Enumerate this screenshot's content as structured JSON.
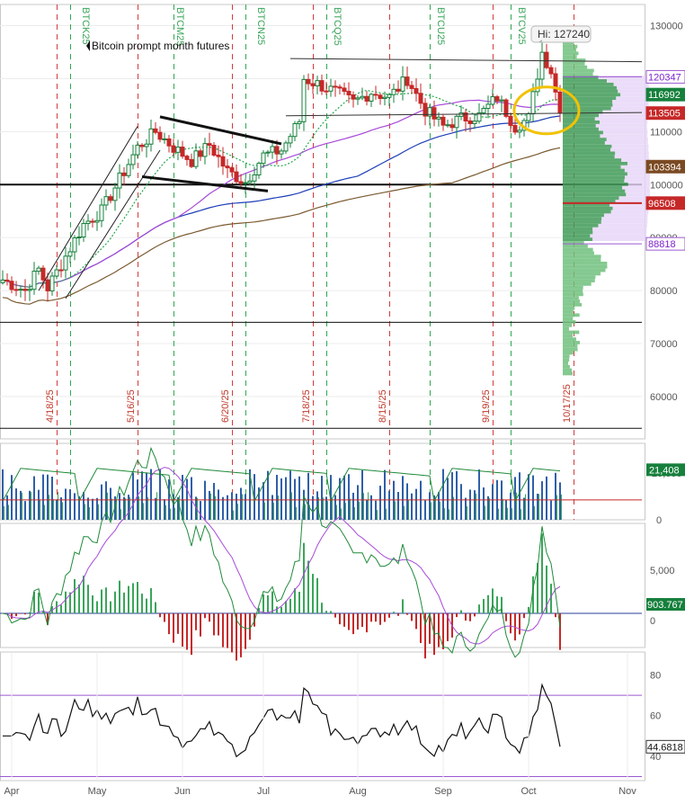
{
  "chart_data": [
    {
      "panel": "price",
      "type": "candlestick",
      "title": "Bitcoin prompt month futures",
      "annotation_high": "Hi: 127240",
      "ylim": [
        52000,
        134000
      ],
      "y_ticks": [
        {
          "value": 130000,
          "label": "130000"
        },
        {
          "value": 120000,
          "label": "120000"
        },
        {
          "value": 110000,
          "label": "110000"
        },
        {
          "value": 100000,
          "label": "100000"
        },
        {
          "value": 90000,
          "label": "90000"
        },
        {
          "value": 80000,
          "label": "80000"
        },
        {
          "value": 70000,
          "label": "70000"
        },
        {
          "value": 60000,
          "label": "60000"
        }
      ],
      "price_labels": [
        {
          "value": 120347,
          "label": "120347",
          "color": "#7e22ce",
          "bg": "#ffffff"
        },
        {
          "value": 116992,
          "label": "116992",
          "color": "#ffffff",
          "bg": "#16803c"
        },
        {
          "value": 113505,
          "label": "113505",
          "color": "#ffffff",
          "bg": "#c62828"
        },
        {
          "value": 103394,
          "label": "103394",
          "color": "#ffffff",
          "bg": "#7b4a22"
        },
        {
          "value": 96508,
          "label": "96508",
          "color": "#ffffff",
          "bg": "#c62828"
        },
        {
          "value": 88818,
          "label": "88818",
          "color": "#7e22ce",
          "bg": "#ffffff"
        }
      ],
      "contract_labels": [
        "BTCK25",
        "BTCM25",
        "BTCN25",
        "BTCQ25",
        "BTCU25",
        "BTCV25"
      ],
      "expiry_dates": [
        "4/18/25",
        "5/16/25",
        "6/20/25",
        "7/18/25",
        "8/15/25",
        "9/19/25",
        "10/17/25"
      ],
      "horizontal_levels": [
        100000,
        74000,
        54000
      ],
      "anchors": [
        [
          0,
          82000
        ],
        [
          5,
          80000
        ],
        [
          8,
          84000
        ],
        [
          10,
          80500
        ],
        [
          14,
          86500
        ],
        [
          18,
          92500
        ],
        [
          22,
          95000
        ],
        [
          26,
          101000
        ],
        [
          30,
          107000
        ],
        [
          34,
          110000
        ],
        [
          38,
          107000
        ],
        [
          42,
          104500
        ],
        [
          46,
          107500
        ],
        [
          50,
          102500
        ],
        [
          54,
          100500
        ],
        [
          58,
          105500
        ],
        [
          62,
          106500
        ],
        [
          66,
          112000
        ],
        [
          67,
          120000
        ],
        [
          70,
          119000
        ],
        [
          74,
          117500
        ],
        [
          78,
          115500
        ],
        [
          82,
          117500
        ],
        [
          86,
          116500
        ],
        [
          90,
          120000
        ],
        [
          94,
          114000
        ],
        [
          98,
          111000
        ],
        [
          102,
          112500
        ],
        [
          106,
          113000
        ],
        [
          110,
          116500
        ],
        [
          114,
          111000
        ],
        [
          117,
          112500
        ],
        [
          120,
          125000
        ],
        [
          122,
          121500
        ],
        [
          124,
          113505
        ]
      ]
    },
    {
      "panel": "volume",
      "type": "bar",
      "value_label": "21,408",
      "y_ticks": [
        {
          "value": 20000,
          "label": "20,000"
        },
        {
          "value": 0,
          "label": "0"
        }
      ]
    },
    {
      "panel": "macd",
      "type": "line",
      "value_label": "903.767",
      "y_ticks": [
        {
          "value": 5000,
          "label": "5,000"
        },
        {
          "value": 0,
          "label": "0"
        }
      ]
    },
    {
      "panel": "rsi",
      "type": "line",
      "value_label": "44.6818",
      "y_ticks": [
        {
          "value": 80,
          "label": "80"
        },
        {
          "value": 60,
          "label": "60"
        },
        {
          "value": 40,
          "label": "40"
        }
      ],
      "levels": [
        70,
        30
      ]
    }
  ],
  "x_axis": {
    "months": [
      {
        "label": "Apr",
        "index": 2
      },
      {
        "label": "May",
        "index": 21
      },
      {
        "label": "Jun",
        "index": 40
      },
      {
        "label": "Jul",
        "index": 58
      },
      {
        "label": "Aug",
        "index": 79
      },
      {
        "label": "Sep",
        "index": 98
      },
      {
        "label": "Oct",
        "index": 117
      },
      {
        "label": "Nov",
        "index": 139
      }
    ]
  },
  "colors": {
    "up": "#16803c",
    "down": "#c62828",
    "ma_green": "#22a84a",
    "ma_purple": "#a84ad8",
    "ma_blue": "#1f3fb8",
    "ma_brown": "#7b5a30"
  }
}
